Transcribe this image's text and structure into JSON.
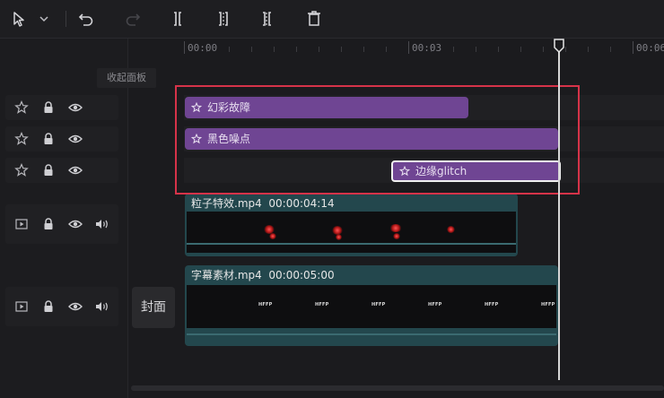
{
  "toolbar": {
    "icons": [
      "select-arrow-icon",
      "dropdown-chevron-icon",
      "undo-icon",
      "redo-icon",
      "split-icon",
      "split-left-icon",
      "split-right-icon",
      "delete-icon"
    ]
  },
  "sidebar": {
    "collapse_label": "收起面板",
    "cover_label": "封面"
  },
  "ruler": {
    "labels": [
      "00:00",
      "00:03",
      "00:06"
    ]
  },
  "tracks": {
    "effects": [
      {
        "label": "幻彩故障"
      },
      {
        "label": "黑色噪点"
      },
      {
        "label": "边缘glitch"
      }
    ],
    "clip1": {
      "name": "粒子特效.mp4",
      "duration": "00:00:04:14"
    },
    "clip2": {
      "name": "字幕素材.mp4",
      "duration": "00:00:05:00",
      "frame_text": "HFFP"
    }
  },
  "colors": {
    "effect": "#6f4593",
    "clip": "#23474d",
    "selection": "#d63349",
    "playhead": "#d7d7d7"
  }
}
